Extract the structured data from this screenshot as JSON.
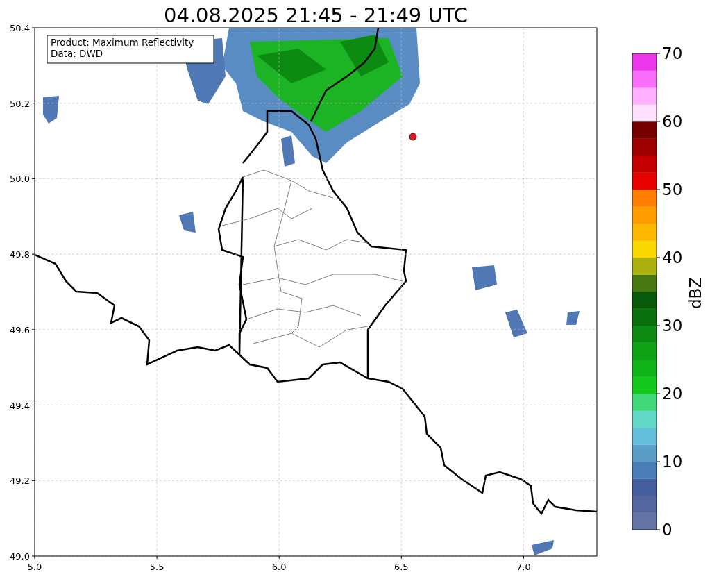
{
  "title": "04.08.2025 21:45 - 21:49 UTC",
  "info_box": {
    "lines": [
      "Product: Maximum Reflectivity",
      "Data: DWD"
    ]
  },
  "map": {
    "y_ticks": [
      "50.4",
      "50.2",
      "50.0",
      "49.8",
      "49.6",
      "49.4",
      "49.2",
      "49.0"
    ],
    "x_ticks": [
      "5.0",
      "5.5",
      "6.0",
      "6.5",
      "7.0"
    ]
  },
  "colorbar": {
    "label": "dBZ",
    "ticks": [
      "70",
      "60",
      "50",
      "40",
      "30",
      "20",
      "10",
      "0"
    ],
    "bands": [
      {
        "color": "#6474a6"
      },
      {
        "color": "#54669e"
      },
      {
        "color": "#445ea0"
      },
      {
        "color": "#4a7cb6"
      },
      {
        "color": "#5a9ec8"
      },
      {
        "color": "#64c0da"
      },
      {
        "color": "#62d8c6"
      },
      {
        "color": "#40d878"
      },
      {
        "color": "#14c81e"
      },
      {
        "color": "#10b41a"
      },
      {
        "color": "#0ea214"
      },
      {
        "color": "#0c8a12"
      },
      {
        "color": "#0a700e"
      },
      {
        "color": "#085a0a"
      },
      {
        "color": "#487810"
      },
      {
        "color": "#acb010"
      },
      {
        "color": "#f8d800"
      },
      {
        "color": "#ffb800"
      },
      {
        "color": "#ff9c00"
      },
      {
        "color": "#ff7e00"
      },
      {
        "color": "#e60000"
      },
      {
        "color": "#c40000"
      },
      {
        "color": "#9e0000"
      },
      {
        "color": "#760000"
      },
      {
        "color": "#ffe0ff"
      },
      {
        "color": "#ffb0ff"
      },
      {
        "color": "#fa6cfa"
      },
      {
        "color": "#ec36ec"
      }
    ]
  }
}
